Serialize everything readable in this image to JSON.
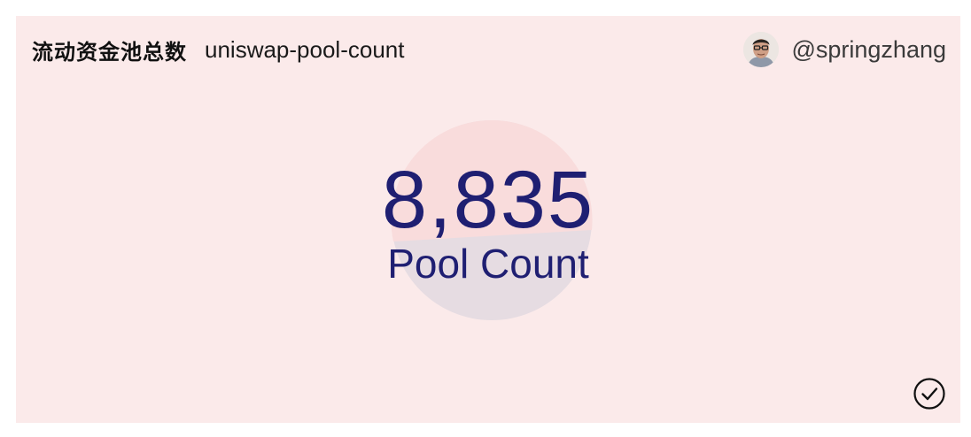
{
  "header": {
    "title_cn": "流动资金池总数",
    "title_slug": "uniswap-pool-count",
    "author": "@springzhang",
    "avatar_icon": "user-avatar"
  },
  "counter": {
    "value": "8,835",
    "label": "Pool Count"
  },
  "colors": {
    "card_background": "#fbeaea",
    "counter_text": "#1f1f72",
    "circle_top": "#f9dcdc",
    "circle_bottom": "#e6dce2"
  },
  "status_icon": "check-circle-icon"
}
